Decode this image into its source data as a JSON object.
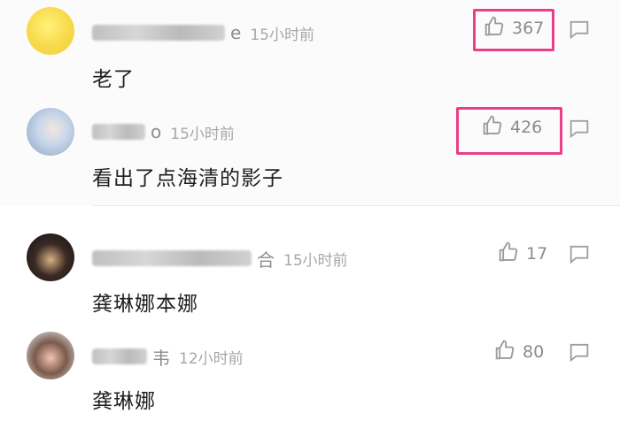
{
  "comments": [
    {
      "name_suffix": "e",
      "time": "15小时前",
      "text": "老了",
      "likes": "367"
    },
    {
      "name_suffix": "o",
      "time": "15小时前",
      "text": "看出了点海清的影子",
      "likes": "426"
    },
    {
      "name_suffix": "合",
      "time": "15小时前",
      "text": "龚琳娜本娜",
      "likes": "17"
    },
    {
      "name_suffix": "韦",
      "time": "12小时前",
      "text": "龚琳娜",
      "likes": "80"
    }
  ],
  "colors": {
    "highlight": "#e83f86",
    "meta_text": "#a7a7a7",
    "comment_text": "#1f1f1f"
  },
  "icons": {
    "like": "thumbs-up-icon",
    "reply": "comment-icon"
  }
}
